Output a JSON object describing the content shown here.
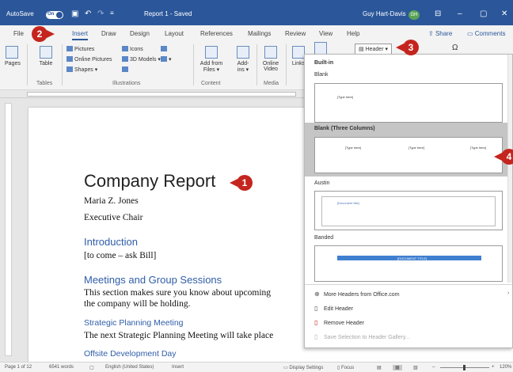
{
  "titlebar": {
    "autosave_label": "AutoSave",
    "autosave_state": "On",
    "doc_title": "Report 1 - Saved",
    "user_name": "Guy Hart-Davis",
    "user_initials": "GH"
  },
  "tabs": [
    "File",
    "Insert",
    "Draw",
    "Design",
    "Layout",
    "References",
    "Mailings",
    "Review",
    "View",
    "Help"
  ],
  "share_label": "Share",
  "comments_label": "Comments",
  "ribbon": {
    "pages": "Pages",
    "table": "Table",
    "tables_group": "Tables",
    "pictures": "Pictures",
    "online_pictures": "Online Pictures",
    "shapes": "Shapes",
    "icons": "Icons",
    "models_3d": "3D Models",
    "illustrations_group": "Illustrations",
    "add_from_files_1": "Add from",
    "add_from_files_2": "Files",
    "addins_1": "Add-",
    "addins_2": "ins",
    "content_group": "Content",
    "online_video_1": "Online",
    "online_video_2": "Video",
    "media_group": "Media",
    "links": "Links",
    "header_button": "Header"
  },
  "document": {
    "title": "Company Report",
    "author": "Maria Z. Jones",
    "role": "Executive Chair",
    "h_intro": "Introduction",
    "intro_text": "[to come – ask Bill]",
    "h_meetings": "Meetings and Group Sessions",
    "meetings_line1": "This section makes sure you know about upcoming",
    "meetings_line2": "the company will be holding.",
    "h_strategic": "Strategic Planning Meeting",
    "strategic_text": "The next Strategic Planning Meeting will take place",
    "h_offsite": "Offsite Development Day"
  },
  "gallery": {
    "builtin": "Built-in",
    "items": [
      {
        "name": "Blank",
        "placeholders": [
          "[Type here]"
        ]
      },
      {
        "name": "Blank (Three Columns)",
        "placeholders": [
          "[Type here]",
          "[Type here]",
          "[Type here]"
        ]
      },
      {
        "name": "Austin",
        "placeholders": [
          "[Document title]"
        ]
      },
      {
        "name": "Banded",
        "placeholders": [
          "[DOCUMENT TITLE]"
        ]
      }
    ],
    "menu": [
      {
        "label": "More Headers from Office.com",
        "icon": "globe-icon"
      },
      {
        "label": "Edit Header",
        "icon": "edit-header-icon"
      },
      {
        "label": "Remove Header",
        "icon": "remove-header-icon"
      },
      {
        "label": "Save Selection to Header Gallery...",
        "icon": "save-selection-icon",
        "disabled": true
      }
    ]
  },
  "callouts": [
    "1",
    "2",
    "3",
    "4"
  ],
  "status": {
    "page": "Page 1 of 12",
    "words": "6541 words",
    "language": "English (United States)",
    "insert": "Insert",
    "display_settings": "Display Settings",
    "focus": "Focus",
    "zoom": "120%"
  },
  "colors": {
    "accent": "#2b579a",
    "callout": "#c4251e",
    "heading": "#2f5da8"
  }
}
